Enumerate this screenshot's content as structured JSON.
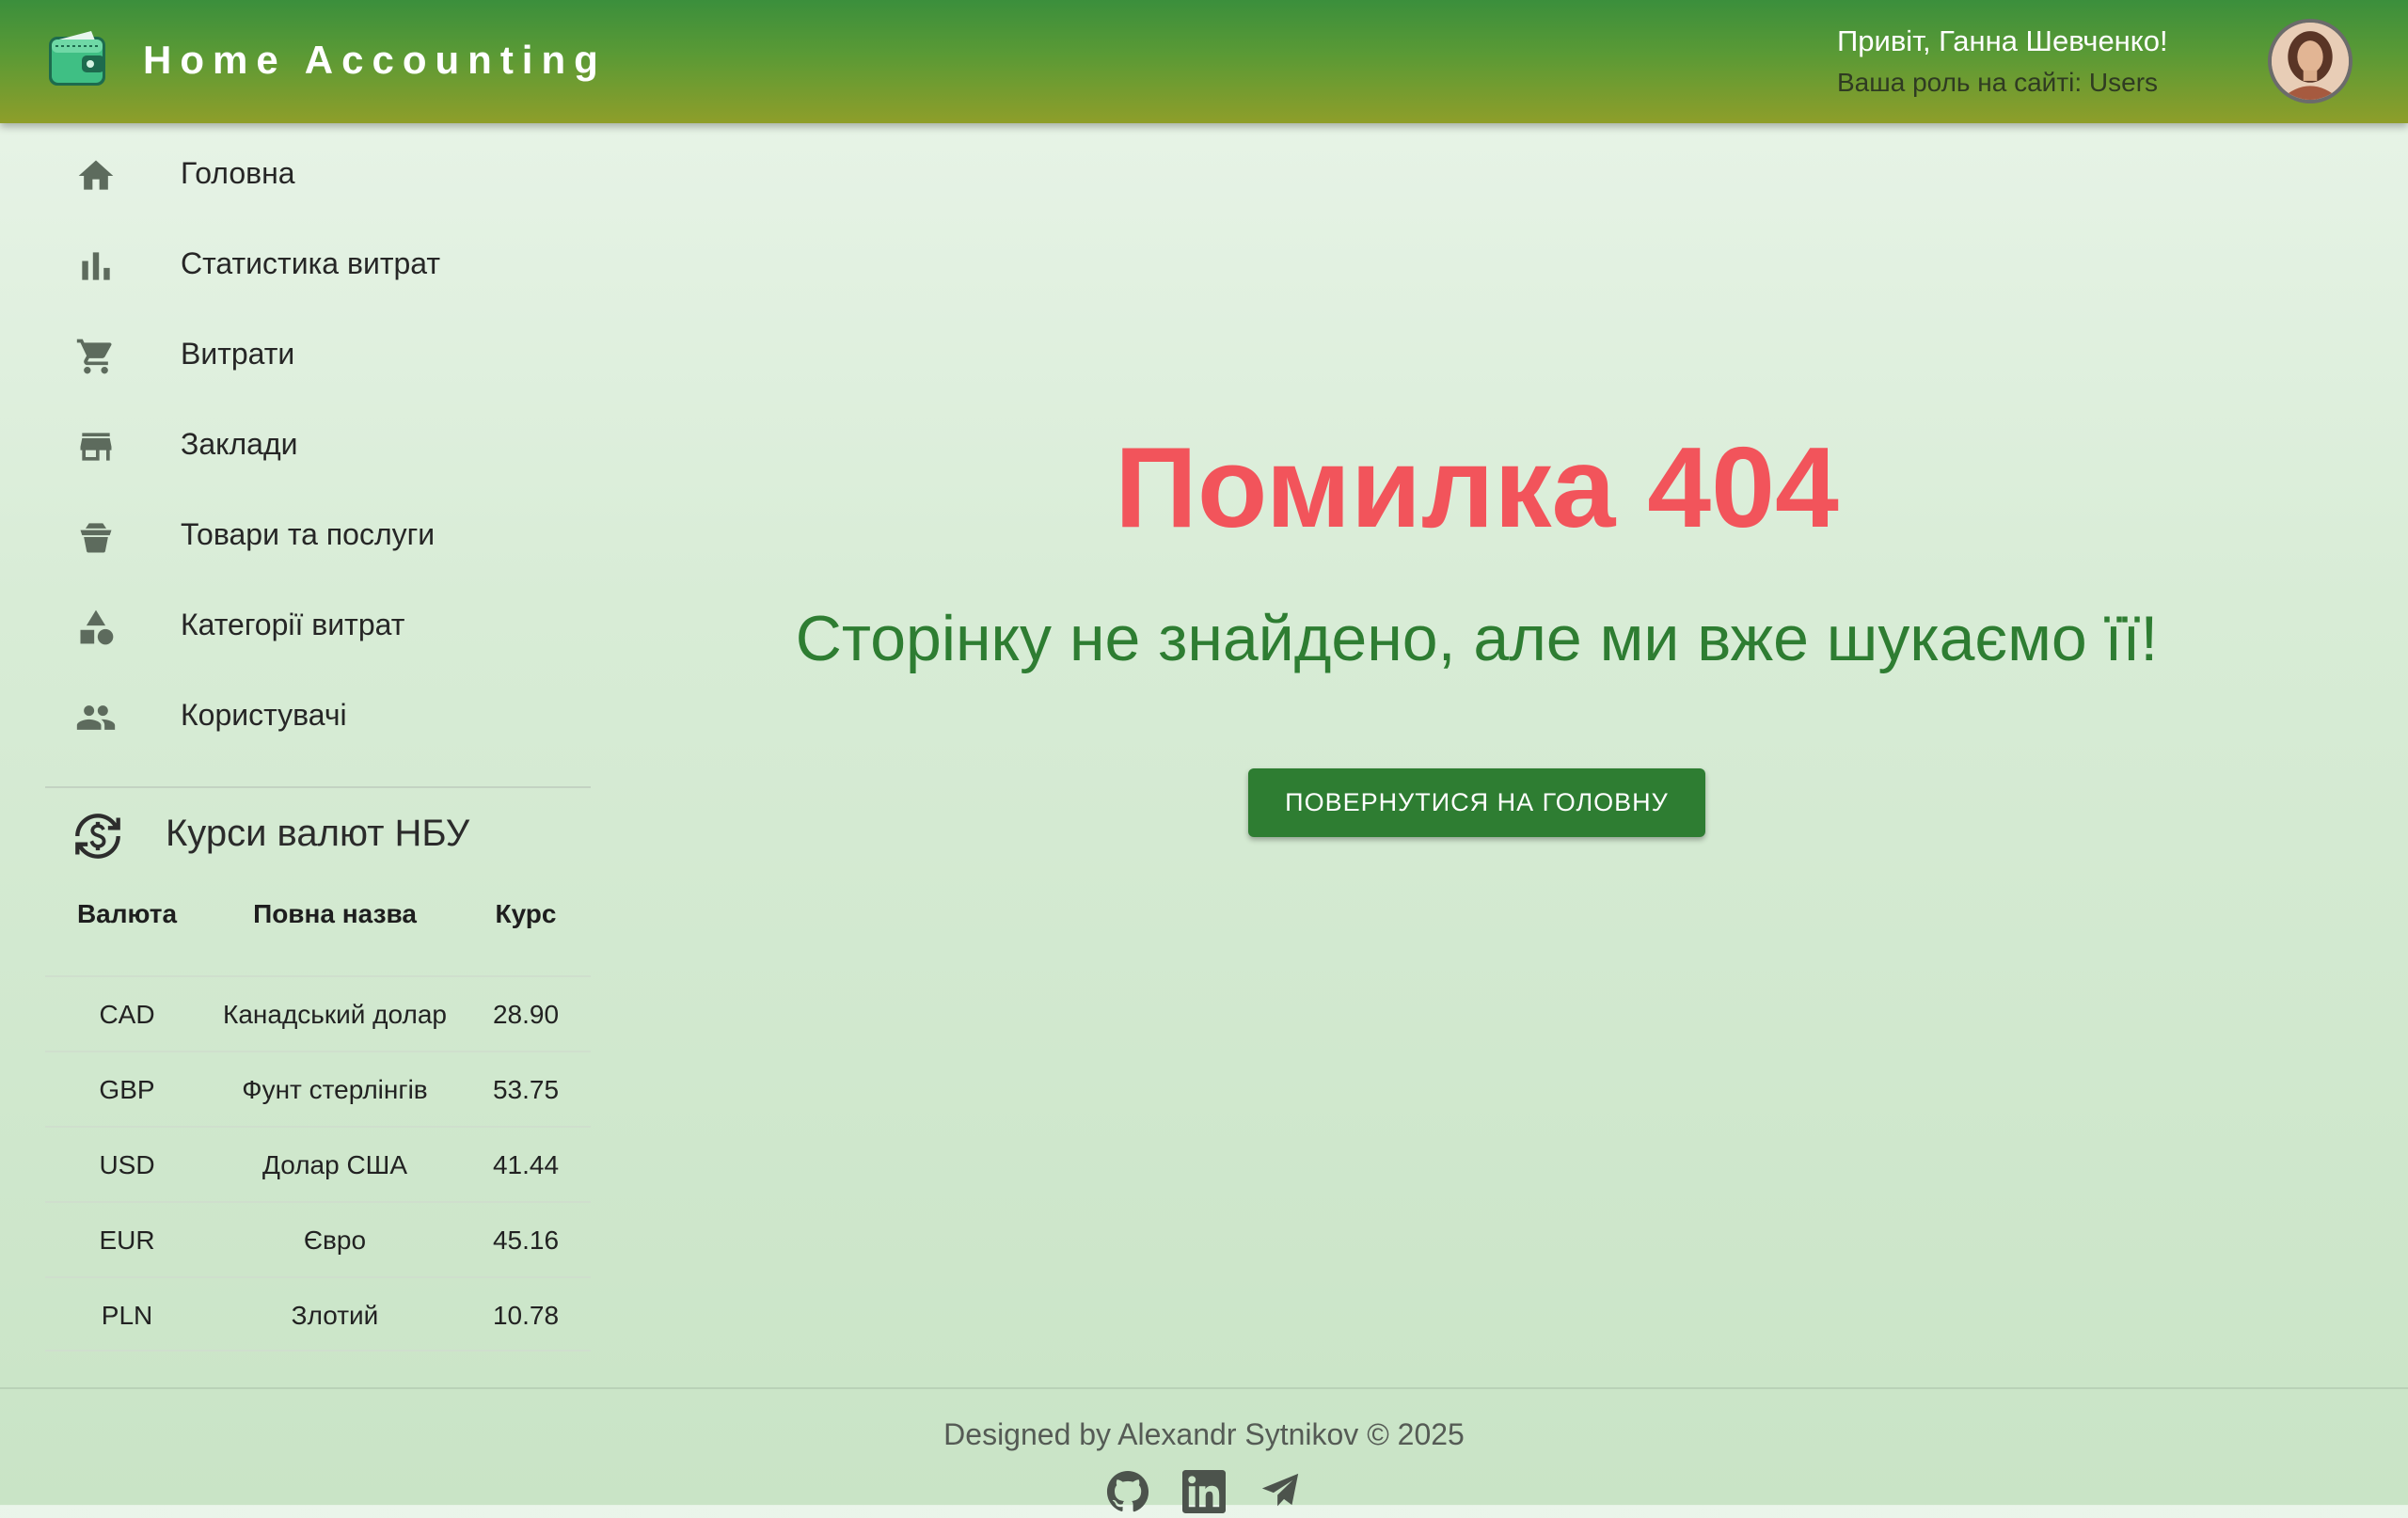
{
  "header": {
    "app_title": "Home Accounting",
    "greeting": "Привіт, Ганна Шевченко!",
    "role": "Ваша роль на сайті: Users"
  },
  "sidebar": {
    "items": [
      {
        "label": "Головна",
        "icon": "home-icon"
      },
      {
        "label": "Статистика витрат",
        "icon": "bar-chart-icon"
      },
      {
        "label": "Витрати",
        "icon": "cart-icon"
      },
      {
        "label": "Заклади",
        "icon": "store-icon"
      },
      {
        "label": "Товари та послуги",
        "icon": "basket-icon"
      },
      {
        "label": "Категорії витрат",
        "icon": "category-icon"
      },
      {
        "label": "Користувачі",
        "icon": "people-icon"
      }
    ]
  },
  "rates": {
    "title": "Курси валют НБУ",
    "headers": [
      "Валюта",
      "Повна назва",
      "Курс"
    ],
    "rows": [
      {
        "code": "CAD",
        "name": "Канадський долар",
        "rate": "28.90"
      },
      {
        "code": "GBP",
        "name": "Фунт стерлінгів",
        "rate": "53.75"
      },
      {
        "code": "USD",
        "name": "Долар США",
        "rate": "41.44"
      },
      {
        "code": "EUR",
        "name": "Євро",
        "rate": "45.16"
      },
      {
        "code": "PLN",
        "name": "Злотий",
        "rate": "10.78"
      }
    ]
  },
  "main": {
    "error_title": "Помилка 404",
    "error_subtitle": "Сторінку не знайдено, але ми вже шукаємо її!",
    "home_button": "ПОВЕРНУТИСЯ НА ГОЛОВНУ"
  },
  "footer": {
    "text": "Designed by Alexandr Sytnikov © 2025",
    "links": [
      "github-icon",
      "linkedin-icon",
      "telegram-icon"
    ]
  },
  "colors": {
    "header_top": "#3b8f3c",
    "header_bottom": "#8e9e2a",
    "error_red": "#f2545b",
    "accent_green": "#2e7d32"
  }
}
